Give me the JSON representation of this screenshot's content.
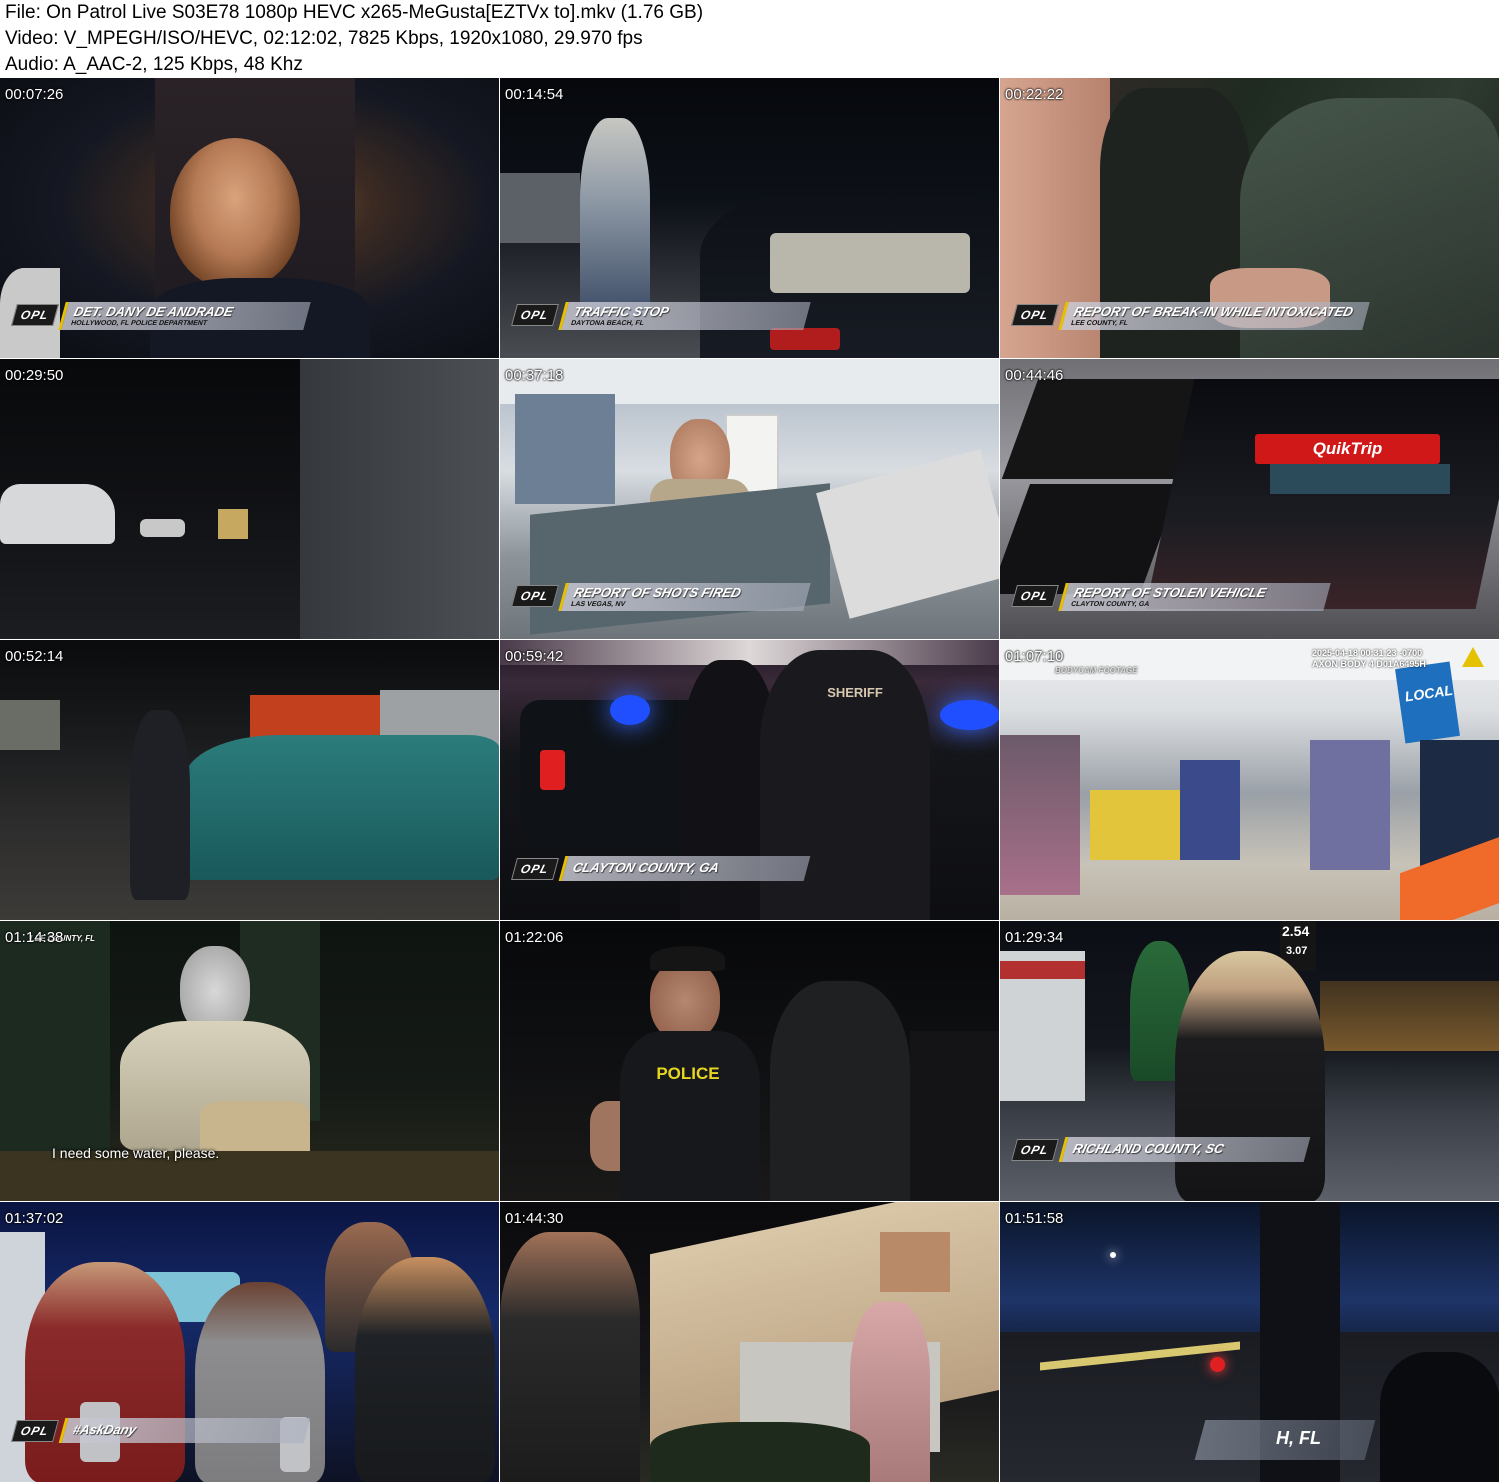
{
  "header": {
    "file_line": "File: On Patrol Live S03E78 1080p HEVC x265-MeGusta[EZTVx to].mkv (1.76 GB)",
    "video_line": "Video: V_MPEGH/ISO/HEVC, 02:12:02, 7825 Kbps, 1920x1080, 29.970 fps",
    "audio_line": "Audio: A_AAC-2, 125 Kbps, 48 Khz"
  },
  "badge": "OPL",
  "thumbnails": [
    {
      "timestamp": "00:07:26",
      "title": "DET. DANY DE ANDRADE",
      "subtitle": "HOLLYWOOD, FL POLICE DEPARTMENT"
    },
    {
      "timestamp": "00:14:54",
      "title": "TRAFFIC STOP",
      "subtitle": "DAYTONA BEACH, FL"
    },
    {
      "timestamp": "00:22:22",
      "title": "REPORT OF BREAK-IN WHILE INTOXICATED",
      "subtitle": "LEE COUNTY, FL"
    },
    {
      "timestamp": "00:29:50"
    },
    {
      "timestamp": "00:37:18",
      "title": "REPORT OF SHOTS FIRED",
      "subtitle": "LAS VEGAS, NV"
    },
    {
      "timestamp": "00:44:46",
      "title": "REPORT OF STOLEN VEHICLE",
      "subtitle": "CLAYTON COUNTY, GA",
      "sign": "QuikTrip"
    },
    {
      "timestamp": "00:52:14"
    },
    {
      "timestamp": "00:59:42",
      "title": "CLAYTON COUNTY, GA",
      "vest": "SHERIFF"
    },
    {
      "timestamp": "01:07:10",
      "tag": "BODYCAM FOOTAGE",
      "axon_line1": "2025-04-18 00:31:23 -0700",
      "axon_line2": "AXON BODY 4 D01A6495H",
      "store_sign": "LOCAL"
    },
    {
      "timestamp": "01:14:38",
      "tag": "LEE COUNTY, FL",
      "caption": "I need some water, please."
    },
    {
      "timestamp": "01:22:06",
      "vest": "POLICE"
    },
    {
      "timestamp": "01:29:34",
      "title": "RICHLAND COUNTY, SC",
      "price1": "2.54",
      "price2": "3.07"
    },
    {
      "timestamp": "01:37:02",
      "title": "#AskDany"
    },
    {
      "timestamp": "01:44:30"
    },
    {
      "timestamp": "01:51:58",
      "title": "H, FL"
    }
  ],
  "colors": {
    "lower_third_accent": "#e8c000",
    "police_blue": "#1f4fff",
    "siren_red": "#e02020",
    "quiktrip_red": "#d01818"
  }
}
